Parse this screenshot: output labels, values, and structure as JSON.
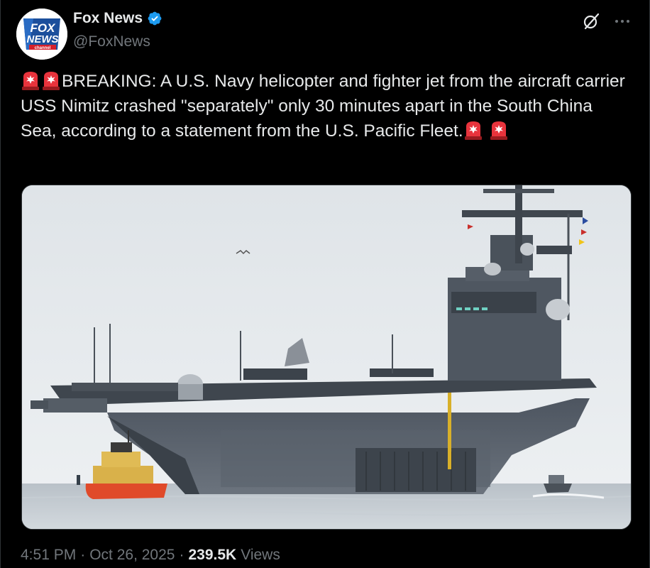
{
  "author": {
    "name": "Fox News",
    "handle": "@FoxNews",
    "verified": true,
    "avatar_logo_text": [
      "FOX",
      "NEWS",
      "channel"
    ]
  },
  "actions": {
    "grok_icon": "grok-icon",
    "more_icon": "more-icon"
  },
  "tweet": {
    "text_main": "BREAKING: A U.S. Navy helicopter and fighter jet from the aircraft carrier USS Nimitz crashed \"separately\" only 30 minutes apart in the South China Sea, according to a statement from the U.S. Pacific Fleet.",
    "emoji": "police-car-light"
  },
  "meta": {
    "time": "4:51 PM",
    "date": "Oct 26, 2025",
    "views_count": "239.5K",
    "views_label": "Views",
    "separator": "·"
  },
  "colors": {
    "background": "#000000",
    "text": "#e7e9ea",
    "secondary": "#71767b",
    "verified_blue": "#1d9bf0"
  }
}
